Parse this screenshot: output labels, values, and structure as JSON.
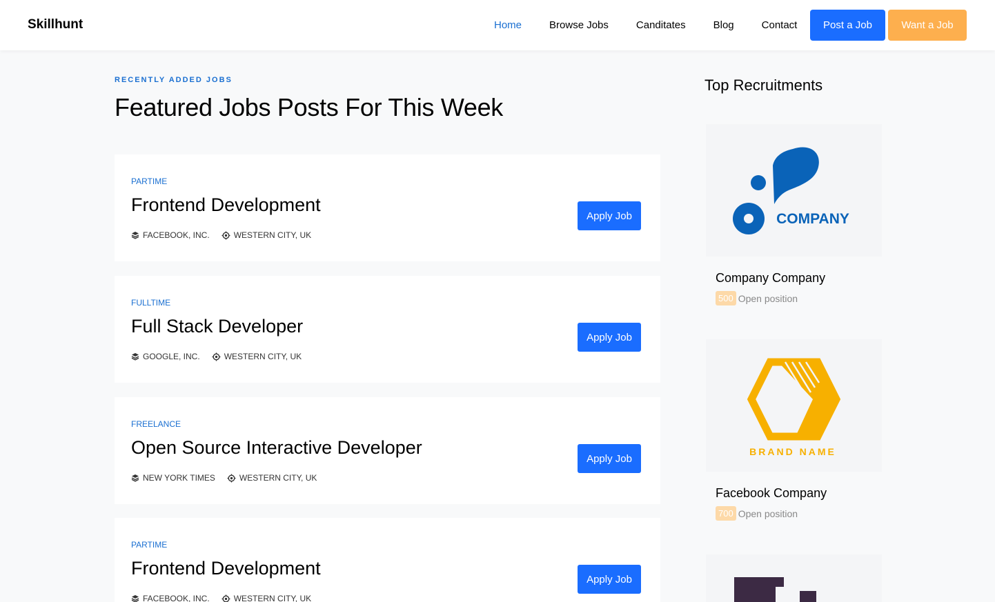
{
  "nav": {
    "brand": "Skillhunt",
    "links": [
      "Home",
      "Browse Jobs",
      "Canditates",
      "Blog",
      "Contact"
    ],
    "post_job": "Post a Job",
    "want_job": "Want a Job"
  },
  "main": {
    "subheading": "RECENTLY ADDED JOBS",
    "heading": "Featured Jobs Posts For This Week",
    "apply_label": "Apply Job",
    "jobs": [
      {
        "type": "PARTIME",
        "title": "Frontend Development",
        "company": "FACEBOOK, INC.",
        "location": "WESTERN CITY, UK"
      },
      {
        "type": "FULLTIME",
        "title": "Full Stack Developer",
        "company": "GOOGLE, INC.",
        "location": "WESTERN CITY, UK"
      },
      {
        "type": "FREELANCE",
        "title": "Open Source Interactive Developer",
        "company": "NEW YORK TIMES",
        "location": "WESTERN CITY, UK"
      },
      {
        "type": "PARTIME",
        "title": "Frontend Development",
        "company": "FACEBOOK, INC.",
        "location": "WESTERN CITY, UK"
      }
    ]
  },
  "sidebar": {
    "title": "Top Recruitments",
    "open_label": "Open position",
    "companies": [
      {
        "name": "Company Company",
        "positions": "500",
        "logo_text": "COMPANY"
      },
      {
        "name": "Facebook Company",
        "positions": "700",
        "logo_text": "BRAND NAME"
      }
    ]
  },
  "colors": {
    "accent": "#1a6fd1",
    "primary_button": "#1a6dff",
    "secondary_button": "#fdaf4e"
  }
}
